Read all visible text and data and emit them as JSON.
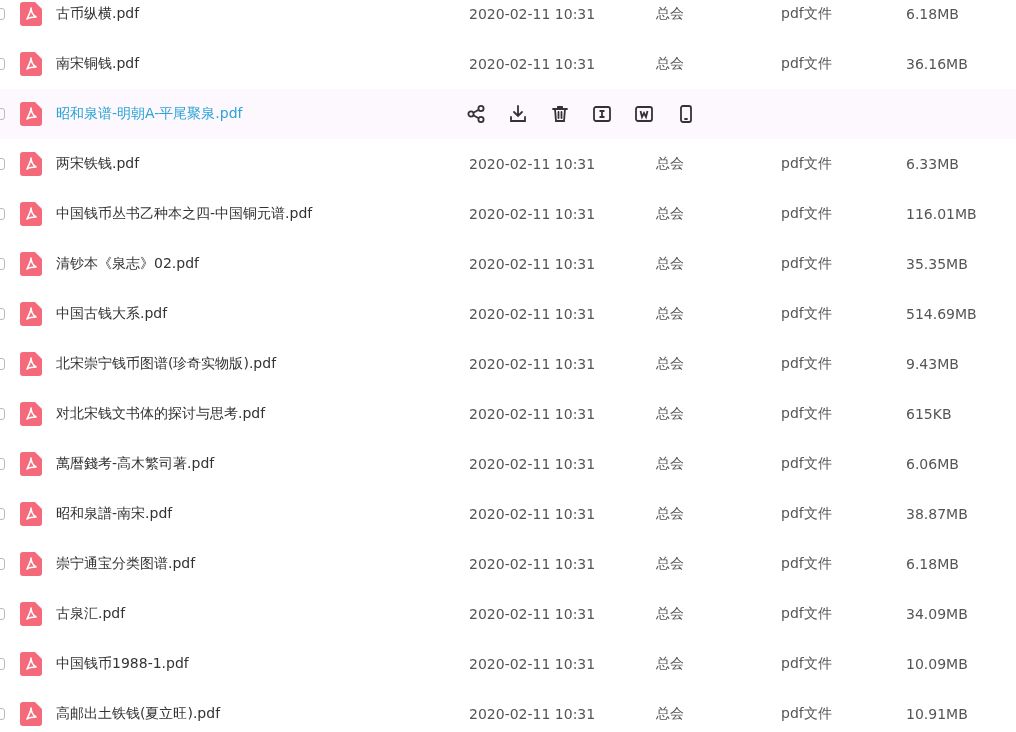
{
  "files": [
    {
      "name": "古币纵横.pdf",
      "modified": "2020-02-11 10:31",
      "owner": "总会",
      "type": "pdf文件",
      "size": "6.18MB",
      "checked": false,
      "hovered": false
    },
    {
      "name": "南宋铜钱.pdf",
      "modified": "2020-02-11 10:31",
      "owner": "总会",
      "type": "pdf文件",
      "size": "36.16MB",
      "checked": false,
      "hovered": false
    },
    {
      "name": "昭和泉谱-明朝A-平尾聚泉.pdf",
      "checked": false,
      "hovered": true
    },
    {
      "name": "两宋铁钱.pdf",
      "modified": "2020-02-11 10:31",
      "owner": "总会",
      "type": "pdf文件",
      "size": "6.33MB",
      "checked": false,
      "hovered": false
    },
    {
      "name": "中国钱币丛书乙种本之四-中国铜元谱.pdf",
      "modified": "2020-02-11 10:31",
      "owner": "总会",
      "type": "pdf文件",
      "size": "116.01MB",
      "checked": false,
      "hovered": false
    },
    {
      "name": "清钞本《泉志》02.pdf",
      "modified": "2020-02-11 10:31",
      "owner": "总会",
      "type": "pdf文件",
      "size": "35.35MB",
      "checked": false,
      "hovered": false
    },
    {
      "name": "中国古钱大系.pdf",
      "modified": "2020-02-11 10:31",
      "owner": "总会",
      "type": "pdf文件",
      "size": "514.69MB",
      "checked": false,
      "hovered": false
    },
    {
      "name": "北宋崇宁钱币图谱(珍奇实物版).pdf",
      "modified": "2020-02-11 10:31",
      "owner": "总会",
      "type": "pdf文件",
      "size": "9.43MB",
      "checked": false,
      "hovered": false
    },
    {
      "name": "对北宋钱文书体的探讨与思考.pdf",
      "modified": "2020-02-11 10:31",
      "owner": "总会",
      "type": "pdf文件",
      "size": "615KB",
      "checked": false,
      "hovered": false
    },
    {
      "name": "萬暦錢考-高木繁司著.pdf",
      "modified": "2020-02-11 10:31",
      "owner": "总会",
      "type": "pdf文件",
      "size": "6.06MB",
      "checked": false,
      "hovered": false
    },
    {
      "name": "昭和泉譜-南宋.pdf",
      "modified": "2020-02-11 10:31",
      "owner": "总会",
      "type": "pdf文件",
      "size": "38.87MB",
      "checked": false,
      "hovered": false
    },
    {
      "name": "崇宁通宝分类图谱.pdf",
      "modified": "2020-02-11 10:31",
      "owner": "总会",
      "type": "pdf文件",
      "size": "6.18MB",
      "checked": false,
      "hovered": false
    },
    {
      "name": "古泉汇.pdf",
      "modified": "2020-02-11 10:31",
      "owner": "总会",
      "type": "pdf文件",
      "size": "34.09MB",
      "checked": false,
      "hovered": false
    },
    {
      "name": "中国钱币1988-1.pdf",
      "modified": "2020-02-11 10:31",
      "owner": "总会",
      "type": "pdf文件",
      "size": "10.09MB",
      "checked": false,
      "hovered": false
    },
    {
      "name": "高邮出土铁钱(夏立旺).pdf",
      "modified": "2020-02-11 10:31",
      "owner": "总会",
      "type": "pdf文件",
      "size": "10.91MB",
      "checked": false,
      "hovered": false
    }
  ]
}
